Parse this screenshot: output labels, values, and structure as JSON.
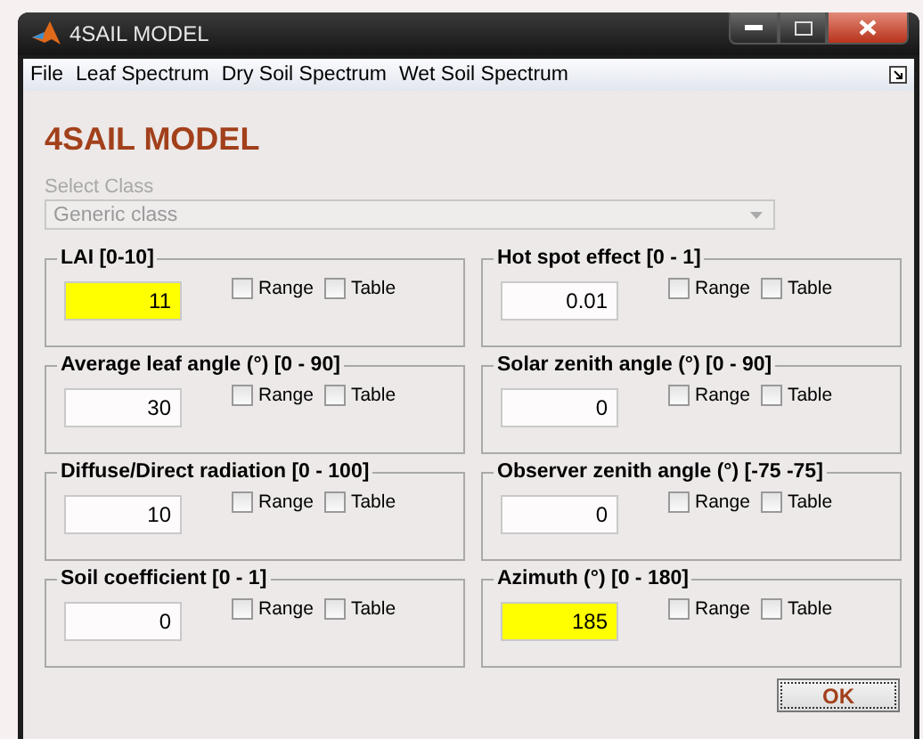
{
  "window": {
    "title": "4SAIL MODEL"
  },
  "menu": [
    "File",
    "Leaf Spectrum",
    "Dry Soil Spectrum",
    "Wet Soil Spectrum"
  ],
  "heading": "4SAIL MODEL",
  "select_class": {
    "label": "Select Class",
    "value": "Generic class",
    "disabled": true
  },
  "groups": [
    {
      "title": "LAI [0-10]",
      "value": "11",
      "highlighted": true,
      "options": [
        {
          "label": "Range",
          "checked": false
        },
        {
          "label": "Table",
          "checked": false
        }
      ]
    },
    {
      "title": "Hot spot effect [0 - 1]",
      "value": "0.01",
      "highlighted": false,
      "options": [
        {
          "label": "Range",
          "checked": false
        },
        {
          "label": "Table",
          "checked": false
        }
      ]
    },
    {
      "title": "Average leaf angle (°) [0 - 90]",
      "value": "30",
      "highlighted": false,
      "options": [
        {
          "label": "Range",
          "checked": false
        },
        {
          "label": "Table",
          "checked": false
        }
      ]
    },
    {
      "title": "Solar zenith angle (°) [0 - 90]",
      "value": "0",
      "highlighted": false,
      "options": [
        {
          "label": "Range",
          "checked": false
        },
        {
          "label": "Table",
          "checked": false
        }
      ]
    },
    {
      "title": "Diffuse/Direct radiation [0 - 100]",
      "value": "10",
      "highlighted": false,
      "options": [
        {
          "label": "Range",
          "checked": false
        },
        {
          "label": "Table",
          "checked": false
        }
      ]
    },
    {
      "title": "Observer zenith angle (°) [-75 -75]",
      "value": "0",
      "highlighted": false,
      "options": [
        {
          "label": "Range",
          "checked": false
        },
        {
          "label": "Table",
          "checked": false
        }
      ]
    },
    {
      "title": "Soil coefficient [0 - 1]",
      "value": "0",
      "highlighted": false,
      "options": [
        {
          "label": "Range",
          "checked": false
        },
        {
          "label": "Table",
          "checked": false
        }
      ]
    },
    {
      "title": "Azimuth (°) [0 - 180]",
      "value": "185",
      "highlighted": true,
      "options": [
        {
          "label": "Range",
          "checked": false
        },
        {
          "label": "Table",
          "checked": false
        }
      ]
    }
  ],
  "buttons": [
    "OK"
  ]
}
